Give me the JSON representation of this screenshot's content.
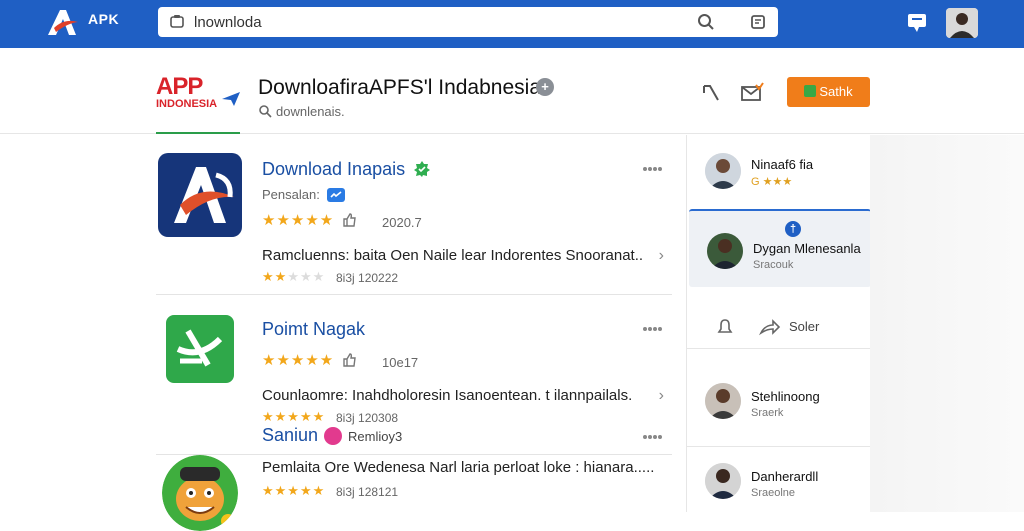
{
  "topbar": {
    "logo_text": "APK",
    "search_value": "lnownloda",
    "colors": {
      "bar": "#1f5fc4"
    }
  },
  "header": {
    "brand_line1": "APP",
    "brand_line2": "INDONESIA",
    "title": "DownloafiraAPFS'l Indabnesia",
    "info_glyph": "+",
    "subtitle": "downlenais.",
    "get_button": "Sathk"
  },
  "apps": [
    {
      "name": "Download Inapais",
      "publisher": "Pensalan:",
      "rating_stars": 5,
      "meta": "2020.7",
      "description": "Ramcluenns: baita Oen Naile lear Indorentes Snooranat..",
      "sub_rating_stars": 2,
      "sub_meta": "8i3j 120222"
    },
    {
      "name": "Poimt Nagak",
      "rating_stars": 5,
      "meta": "10e17",
      "description": "Counlaomre: Inahdholoresin Isanoentean. t ilannpailals.",
      "sub_rating_stars": 5,
      "sub_meta": "8i3j 120308"
    },
    {
      "name": "Saniun",
      "tag": "Remlioy3",
      "description": "Pemlaita Ore Wedenesa Narl laria perloat loke : hianara.....",
      "sub_rating_stars": 5,
      "sub_meta": "8i3j 128121"
    }
  ],
  "right_panel": {
    "items": [
      {
        "name": "Ninaaf6 fia",
        "sub": "G ★★★"
      },
      {
        "name": "Dygan Mlenesanla",
        "sub": "Sracouk"
      },
      {
        "name": "Stehlinoong",
        "sub": "Sraerk"
      },
      {
        "name": "Danherardll",
        "sub": "Sraeolne"
      }
    ],
    "card_pin": "†",
    "action_label": "Soler"
  }
}
